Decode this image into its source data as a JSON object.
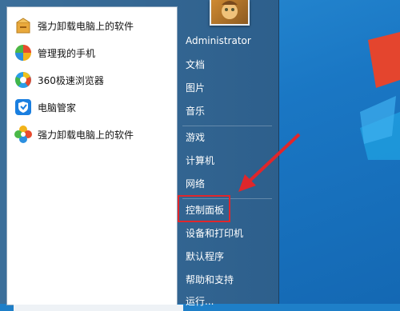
{
  "start_menu": {
    "programs": [
      {
        "label": "强力卸载电脑上的软件",
        "icon": "uninstall-box-icon"
      },
      {
        "label": "管理我的手机",
        "icon": "phone-manager-icon"
      },
      {
        "label": "360极速浏览器",
        "icon": "browser-360-icon"
      },
      {
        "label": "电脑管家",
        "icon": "pc-manager-shield-icon"
      },
      {
        "label": "强力卸载电脑上的软件",
        "icon": "pinwheel-icon"
      }
    ],
    "user": "Administrator",
    "places": [
      "文档",
      "图片",
      "音乐",
      "游戏",
      "计算机",
      "网络",
      "控制面板",
      "设备和打印机",
      "默认程序",
      "帮助和支持",
      "运行..."
    ]
  },
  "annotation": {
    "highlight_color": "#e0262b",
    "target": "控制面板"
  }
}
